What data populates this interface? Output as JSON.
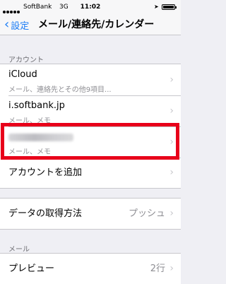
{
  "status_bar": {
    "carrier": "SoftBank",
    "network": "3G",
    "time": "11:02"
  },
  "nav": {
    "back_label": "設定",
    "title": "メール/連絡先/カレンダー"
  },
  "accounts": {
    "header": "アカウント",
    "items": [
      {
        "title": "iCloud",
        "subtitle": "メール、連絡先とその他9項目..."
      },
      {
        "title": "i.softbank.jp",
        "subtitle": "メール、メモ"
      },
      {
        "title": "",
        "subtitle": "メール、メモ"
      }
    ],
    "add_label": "アカウントを追加"
  },
  "fetch": {
    "label": "データの取得方法",
    "value": "プッシュ"
  },
  "mail": {
    "header": "メール",
    "preview_label": "プレビュー",
    "preview_value": "2行"
  },
  "colors": {
    "accent": "#1a7cf5",
    "highlight": "#e8001a",
    "background": "#efeff4"
  },
  "icons": {
    "back": "chevron-left-icon",
    "disclosure": "chevron-right-icon"
  }
}
